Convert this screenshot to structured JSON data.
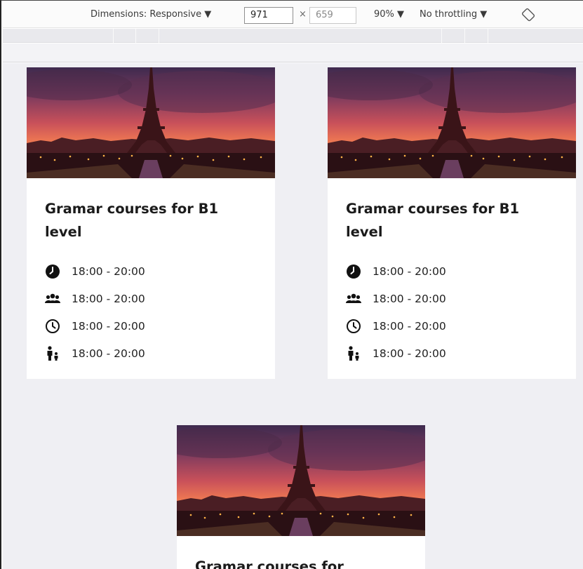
{
  "toolbar": {
    "dimensions_label": "Dimensions: Responsive ▼",
    "width_value": "971",
    "times": "×",
    "height_value": "659",
    "zoom_label": "90% ▼",
    "throttling_label": "No throttling ▼",
    "rotate_icon": "rotate-icon"
  },
  "cards": [
    {
      "title": "Gramar courses for B1 level",
      "image": "eiffel-tower-sunset-photo",
      "rows": [
        {
          "icon": "clock-filled-icon",
          "text": "18:00 - 20:00"
        },
        {
          "icon": "users-icon",
          "text": "18:00 - 20:00"
        },
        {
          "icon": "clock-outline-icon",
          "text": "18:00 - 20:00"
        },
        {
          "icon": "parent-child-icon",
          "text": "18:00 - 20:00"
        }
      ]
    },
    {
      "title": "Gramar courses for B1 level",
      "image": "eiffel-tower-sunset-photo",
      "rows": [
        {
          "icon": "clock-filled-icon",
          "text": "18:00 - 20:00"
        },
        {
          "icon": "users-icon",
          "text": "18:00 - 20:00"
        },
        {
          "icon": "clock-outline-icon",
          "text": "18:00 - 20:00"
        },
        {
          "icon": "parent-child-icon",
          "text": "18:00 - 20:00"
        }
      ]
    },
    {
      "title": "Gramar courses for",
      "image": "eiffel-tower-sunset-photo"
    }
  ],
  "colors": {
    "viewport_bg": "#efeff3",
    "card_bg": "#ffffff",
    "text": "#1b1b1b"
  }
}
